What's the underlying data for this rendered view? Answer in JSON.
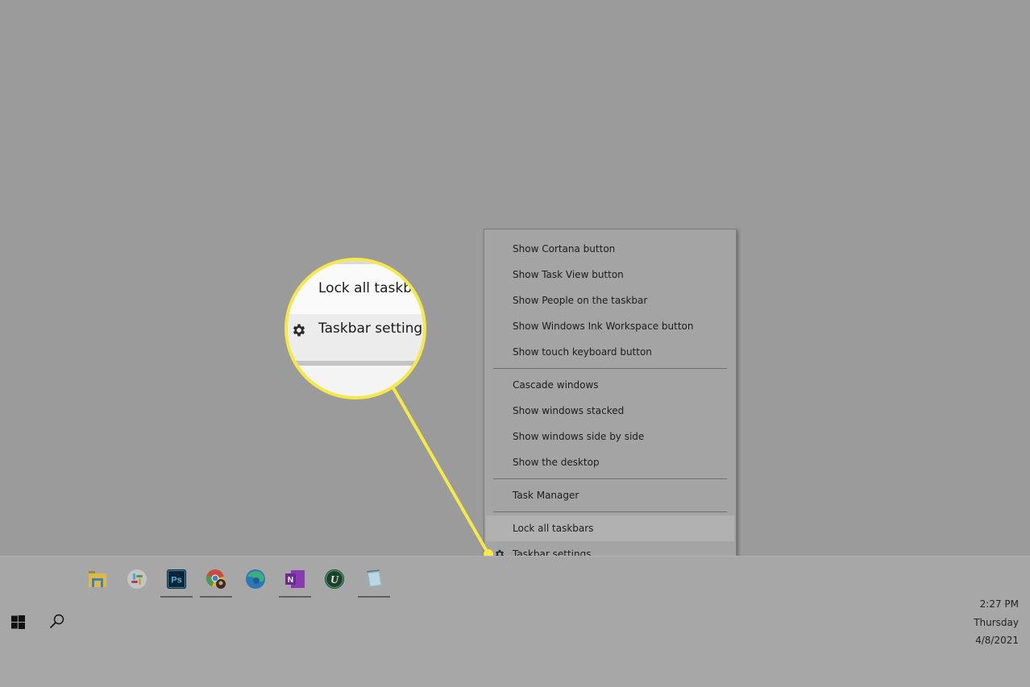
{
  "context_menu": {
    "groups": [
      [
        "Show Cortana button",
        "Show Task View button",
        "Show People on the taskbar",
        "Show Windows Ink Workspace button",
        "Show touch keyboard button"
      ],
      [
        "Cascade windows",
        "Show windows stacked",
        "Show windows side by side",
        "Show the desktop"
      ],
      [
        "Task Manager"
      ],
      [
        "Lock all taskbars",
        "Taskbar settings"
      ]
    ],
    "hovered_item": "Lock all taskbars",
    "icons": {
      "Taskbar settings": "gear-icon"
    }
  },
  "magnifier": {
    "line1": "Lock all taskba",
    "line2": "Taskbar settings",
    "icon": "gear-icon",
    "accent_color": "#f5e94a"
  },
  "taskbar": {
    "start_icon": "windows-logo-icon",
    "search_icon": "search-icon",
    "apps": [
      {
        "name": "File Explorer",
        "icon": "file-explorer-icon",
        "running": false
      },
      {
        "name": "Slack",
        "icon": "slack-icon",
        "running": false
      },
      {
        "name": "Photoshop",
        "icon": "photoshop-icon",
        "label": "Ps",
        "running": true
      },
      {
        "name": "Chrome",
        "icon": "chrome-icon",
        "running": true
      },
      {
        "name": "Edge",
        "icon": "edge-icon",
        "running": false
      },
      {
        "name": "OneNote",
        "icon": "onenote-icon",
        "label": "N",
        "running": true
      },
      {
        "name": "Upwork",
        "icon": "upwork-icon",
        "label": "U",
        "running": false
      },
      {
        "name": "Notepad",
        "icon": "notepad-icon",
        "running": true
      }
    ],
    "clock": {
      "time": "2:27 PM",
      "day": "Thursday",
      "date": "4/8/2021"
    }
  }
}
